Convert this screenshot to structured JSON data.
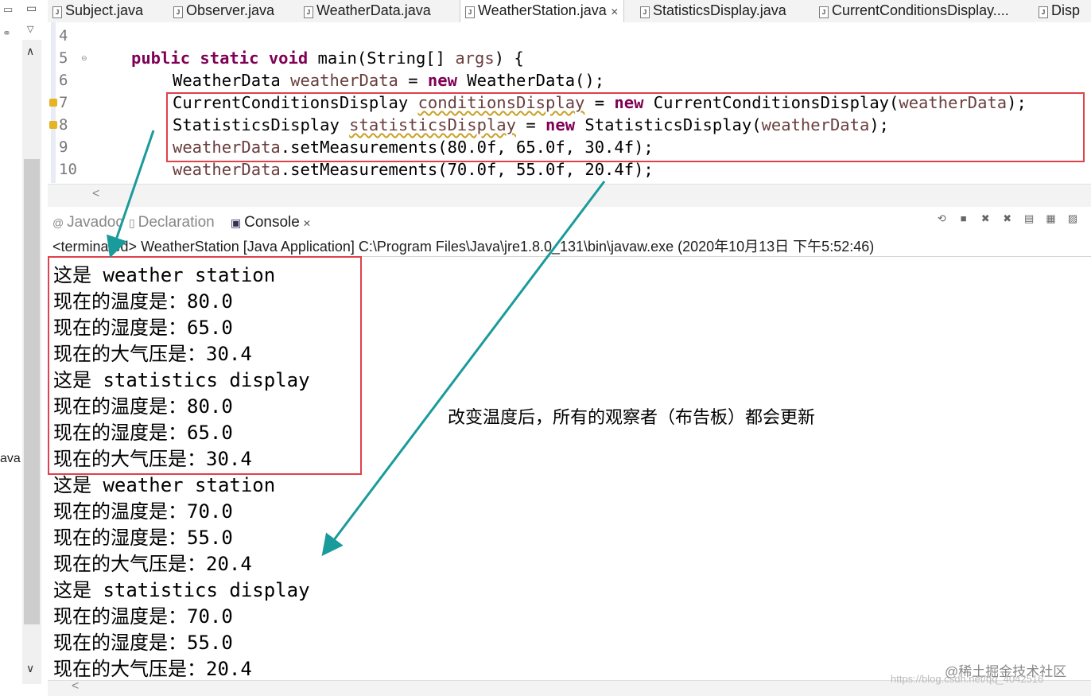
{
  "tabs": [
    {
      "label": "Subject.java",
      "active": false
    },
    {
      "label": "Observer.java",
      "active": false
    },
    {
      "label": "WeatherData.java",
      "active": false
    },
    {
      "label": "WeatherStation.java",
      "active": true
    },
    {
      "label": "StatisticsDisplay.java",
      "active": false
    },
    {
      "label": "CurrentConditionsDisplay....",
      "active": false
    },
    {
      "label": "Disp",
      "active": false
    }
  ],
  "left_panel": {
    "label": "ava"
  },
  "editor": {
    "line_numbers": [
      "4",
      "5",
      "6",
      "7",
      "8",
      "9",
      "10"
    ],
    "lines": {
      "l5": {
        "kw1": "public",
        "kw2": "static",
        "kw3": "void",
        "rest": " main(String[] ",
        "param": "args",
        "tail": ") {"
      },
      "l6": {
        "type": "WeatherData ",
        "var": "weatherData",
        "mid": " = ",
        "kw": "new",
        "tail": " WeatherData();"
      },
      "l7": {
        "type": "CurrentConditionsDisplay ",
        "var": "conditionsDisplay",
        "mid": " = ",
        "kw": "new",
        "tail": " CurrentConditionsDisplay(",
        "arg": "weatherData",
        "end": ");"
      },
      "l8": {
        "type": "StatisticsDisplay ",
        "var": "statisticsDisplay",
        "mid": " = ",
        "kw": "new",
        "tail": " StatisticsDisplay(",
        "arg": "weatherData",
        "end": ");"
      },
      "l9": {
        "var": "weatherData",
        "tail": ".setMeasurements(80.0f, 65.0f, 30.4f);"
      },
      "l10": {
        "var": "weatherData",
        "tail": ".setMeasurements(70.0f, 55.0f, 20.4f);"
      }
    }
  },
  "views": {
    "javadoc": "Javadoc",
    "declaration": "Declaration",
    "console": "Console"
  },
  "console": {
    "header": "<terminated> WeatherStation [Java Application] C:\\Program Files\\Java\\jre1.8.0_131\\bin\\javaw.exe (2020年10月13日 下午5:52:46)",
    "lines": [
      "这是 weather station",
      "现在的温度是：80.0",
      "现在的湿度是：65.0",
      "现在的大气压是：30.4",
      "这是 statistics display",
      "现在的温度是：80.0",
      "现在的湿度是：65.0",
      "现在的大气压是：30.4",
      "这是 weather station",
      "现在的温度是：70.0",
      "现在的湿度是：55.0",
      "现在的大气压是：20.4",
      "这是 statistics display",
      "现在的温度是：70.0",
      "现在的湿度是：55.0",
      "现在的大气压是：20.4"
    ]
  },
  "annotation": {
    "text": "改变温度后，所有的观察者（布告板）都会更新"
  },
  "watermark": {
    "text": "@稀土掘金技术社区",
    "url": "https://blog.csdn.net/qq_4042516"
  },
  "colors": {
    "keyword": "#7f0055",
    "local_var": "#6a3e3e",
    "highlight_box": "#e0414a",
    "arrow": "#1a9b9b"
  }
}
